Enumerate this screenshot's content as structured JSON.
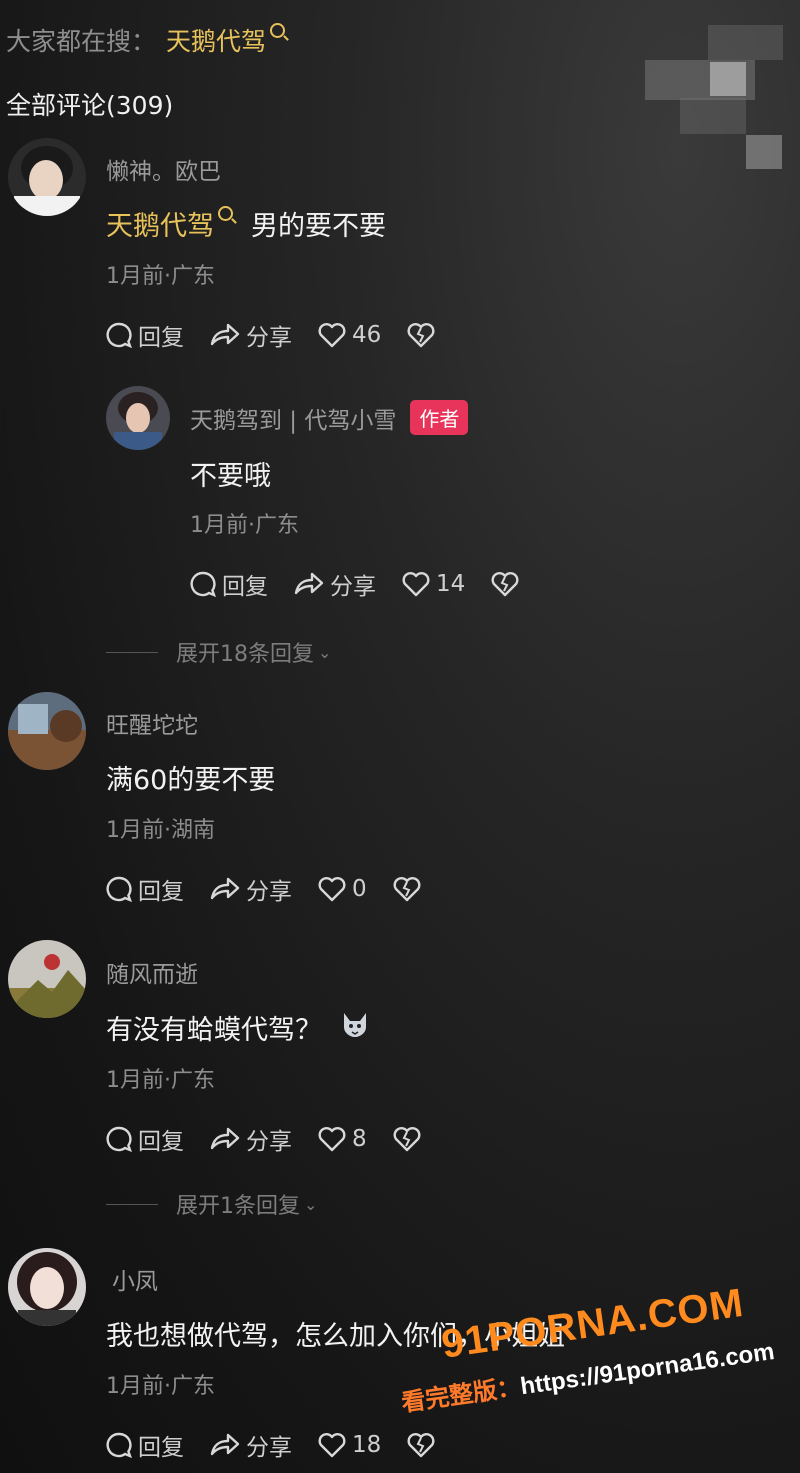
{
  "search": {
    "prefix": "大家都在搜：",
    "keyword": "天鹅代驾"
  },
  "comments_total": "全部评论(309)",
  "comments": [
    {
      "user": "懒神。欧巴",
      "keyword": "天鹅代驾",
      "text": "男的要不要",
      "meta": "1月前·广东",
      "reply_label": "回复",
      "share_label": "分享",
      "likes": "46",
      "reply": {
        "user": "天鹅驾到 | 代驾小雪",
        "badge": "作者",
        "text": "不要哦",
        "meta": "1月前·广东",
        "reply_label": "回复",
        "share_label": "分享",
        "likes": "14"
      },
      "expand": "展开18条回复"
    },
    {
      "user": "旺醒坨坨",
      "text": "满60的要不要",
      "meta": "1月前·湖南",
      "reply_label": "回复",
      "share_label": "分享",
      "likes": "0"
    },
    {
      "user": "随风而逝",
      "text": "有没有蛤蟆代驾？",
      "emoji": "🐺",
      "meta": "1月前·广东",
      "reply_label": "回复",
      "share_label": "分享",
      "likes": "8",
      "expand": "展开1条回复"
    },
    {
      "user": "小凤",
      "text": "我也想做代驾，怎么加入你们，小姐姐",
      "meta": "1月前·广东",
      "reply_label": "回复",
      "share_label": "分享",
      "likes": "18"
    }
  ],
  "watermark": {
    "logo": "91PORNA.COM",
    "prefix": "看完整版：",
    "url": "https://91porna16.com"
  },
  "colors": {
    "keyword": "#e7c25a",
    "author_badge": "#e8345a",
    "watermark": "#ff8a1e"
  }
}
